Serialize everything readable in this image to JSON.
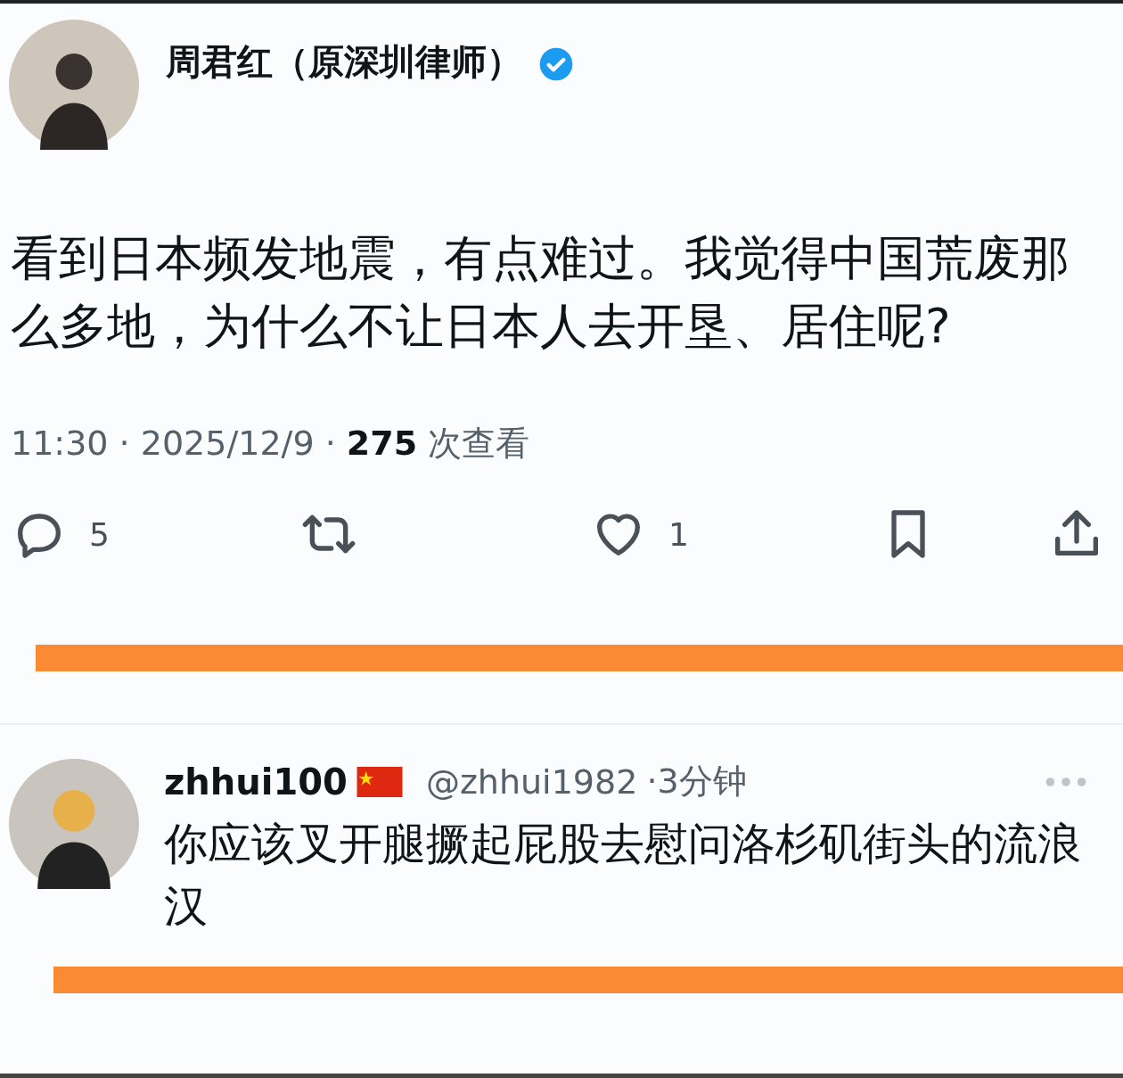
{
  "post": {
    "author": "周君红（原深圳律师）",
    "verified": true,
    "text": "看到日本频发地震，有点难过。我觉得中国荒废那么多地，为什么不让日本人去开垦、居住呢?",
    "meta": "11:30 · 2025/12/9 · **275** 次查看",
    "actions": [
      {
        "kind": "reply",
        "count": "5"
      },
      {
        "kind": "repost"
      },
      {
        "kind": "like",
        "count": "1"
      },
      {
        "kind": "bookmark"
      },
      {
        "kind": "share"
      }
    ]
  },
  "reply": {
    "name": "zhhui100",
    "handle": "@zhhui1982",
    "time": "·3分钟",
    "text": "你应该叉开腿撅起屁股去慰问洛杉矶街头的流浪汉"
  }
}
